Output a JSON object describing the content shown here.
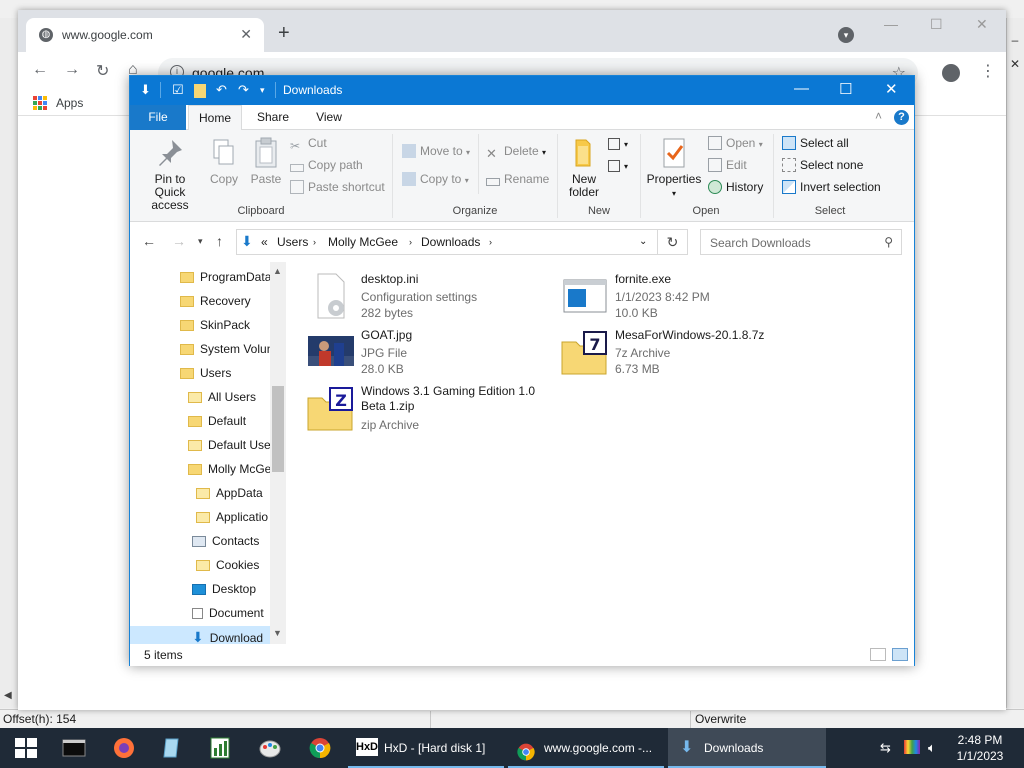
{
  "hxd": {
    "title": "HxD - [Hard disk 1]",
    "status_offset": "Offset(h): 154",
    "status_mode": "Overwrite"
  },
  "chrome": {
    "tab_title": "www.google.com",
    "url": "google.com",
    "bookmarks_apps": "Apps",
    "newtab_glyph": "+",
    "close_glyph": "✕"
  },
  "explorer": {
    "title": "Downloads",
    "tabs": {
      "file": "File",
      "home": "Home",
      "share": "Share",
      "view": "View"
    },
    "ribbon": {
      "clipboard": {
        "label": "Clipboard",
        "pin_line1": "Pin to Quick",
        "pin_line2": "access",
        "copy": "Copy",
        "paste": "Paste",
        "cut": "Cut",
        "copy_path": "Copy path",
        "paste_shortcut": "Paste shortcut"
      },
      "organize": {
        "label": "Organize",
        "move_to": "Move to",
        "copy_to": "Copy to",
        "delete": "Delete",
        "rename": "Rename"
      },
      "new": {
        "label": "New",
        "new_folder_line1": "New",
        "new_folder_line2": "folder"
      },
      "open": {
        "label": "Open",
        "properties": "Properties",
        "open": "Open",
        "edit": "Edit",
        "history": "History"
      },
      "select": {
        "label": "Select",
        "select_all": "Select all",
        "select_none": "Select none",
        "invert_selection": "Invert selection"
      }
    },
    "breadcrumb": {
      "prefix": "«",
      "items": [
        "Users",
        "Molly McGee",
        "Downloads"
      ]
    },
    "search_placeholder": "Search Downloads",
    "nav_items": [
      "ProgramData",
      "Recovery",
      "SkinPack",
      "System Volun",
      "Users",
      "All Users",
      "Default",
      "Default User",
      "Molly McGe",
      "AppData",
      "Applicatio",
      "Contacts",
      "Cookies",
      "Desktop",
      "Document",
      "Download"
    ],
    "files": [
      {
        "name": "desktop.ini",
        "meta1": "Configuration settings",
        "meta2": "282 bytes",
        "icon": "settings-file-icon"
      },
      {
        "name": "fornite.exe",
        "meta1": "1/1/2023 8:42 PM",
        "meta2": "10.0 KB",
        "icon": "exe-window-icon"
      },
      {
        "name": "GOAT.jpg",
        "meta1": "JPG File",
        "meta2": "28.0 KB",
        "icon": "photo-thumbnail-icon"
      },
      {
        "name": "MesaForWindows-20.1.8.7z",
        "meta1": "7z Archive",
        "meta2": "6.73 MB",
        "icon": "7zip-archive-icon"
      },
      {
        "name": "Windows 3.1 Gaming Edition 1.0 Beta 1.zip",
        "meta1": "zip Archive",
        "meta2": "",
        "icon": "zip-archive-icon"
      }
    ],
    "status_count": "5 items"
  },
  "taskbar": {
    "apps": [
      {
        "label": "HxD - [Hard disk 1]",
        "icon": "hxd-icon"
      },
      {
        "label": "www.google.com -...",
        "icon": "chrome-icon"
      },
      {
        "label": "Downloads",
        "icon": "explorer-icon"
      }
    ],
    "time": "2:48 PM",
    "date": "1/1/2023"
  },
  "colors": {
    "explorer_title": "#0b78d4",
    "taskbar": "#1f2a37",
    "folder": "#f7d774",
    "accent": "#1979ca"
  }
}
